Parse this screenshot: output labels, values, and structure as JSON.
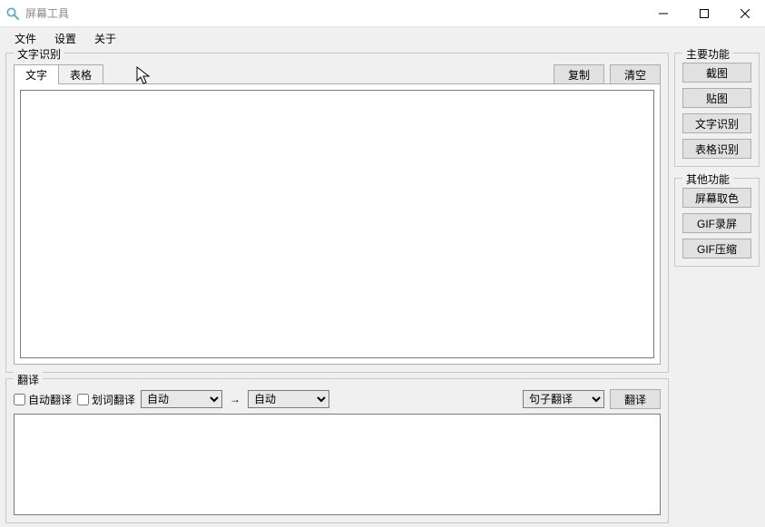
{
  "window": {
    "title": "屏幕工具"
  },
  "menu": {
    "file": "文件",
    "settings": "设置",
    "about": "关于"
  },
  "ocr": {
    "legend": "文字识别",
    "tabs": {
      "text": "文字",
      "table": "表格"
    },
    "copy_btn": "复制",
    "clear_btn": "清空",
    "content": ""
  },
  "translate": {
    "legend": "翻译",
    "auto_translate_label": "自动翻译",
    "word_translate_label": "划词翻译",
    "src_lang": "自动",
    "dst_lang": "自动",
    "mode": "句子翻译",
    "translate_btn": "翻译",
    "output": ""
  },
  "sidebar": {
    "main_legend": "主要功能",
    "other_legend": "其他功能",
    "screenshot": "截图",
    "paste_image": "贴图",
    "text_ocr": "文字识别",
    "table_ocr": "表格识别",
    "color_picker": "屏幕取色",
    "gif_record": "GIF录屏",
    "gif_compress": "GIF压缩"
  }
}
